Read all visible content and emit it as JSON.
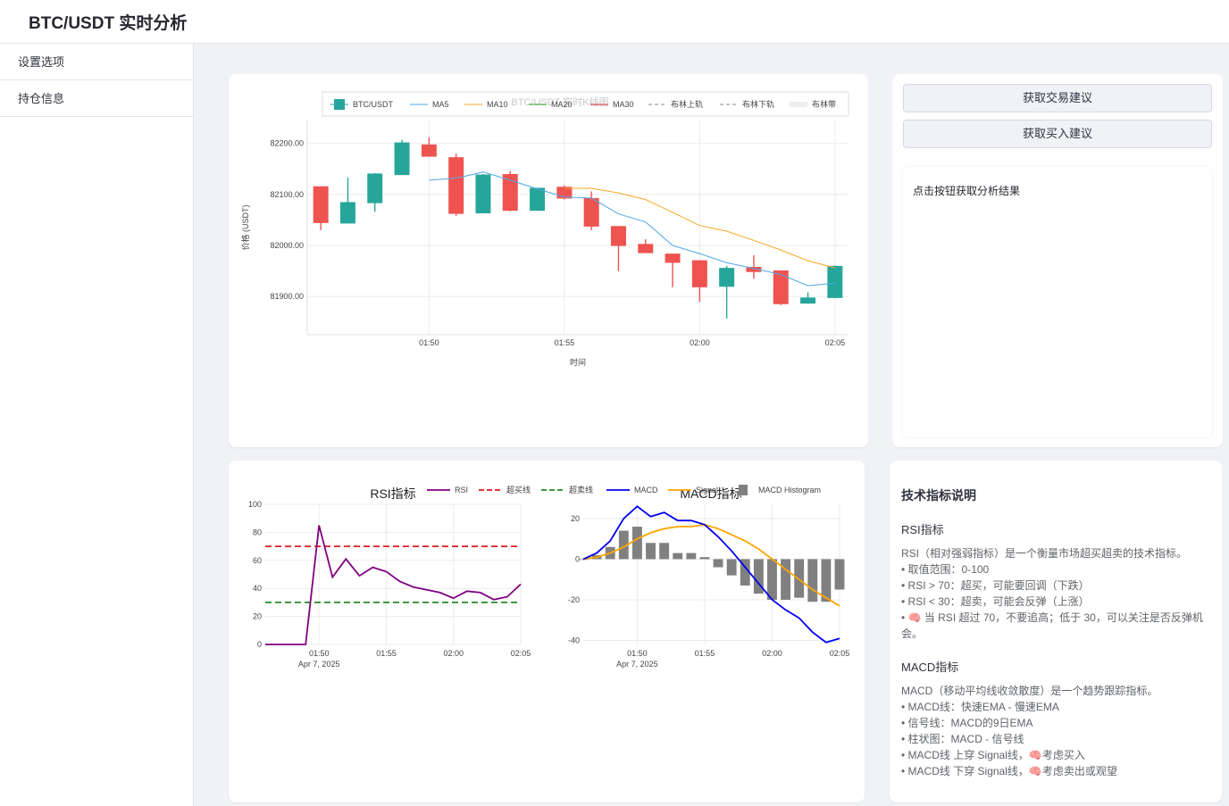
{
  "app": {
    "title": "BTC/USDT 实时分析"
  },
  "sidebar": {
    "items": [
      {
        "label": "设置选项"
      },
      {
        "label": "持仓信息"
      }
    ]
  },
  "actions": {
    "trade_advice_label": "获取交易建议",
    "buy_advice_label": "获取买入建议",
    "result_placeholder": "点击按钮获取分析结果"
  },
  "docs": {
    "title": "技术指标说明",
    "rsi": {
      "heading": "RSI指标",
      "lines": [
        "RSI（相对强弱指标）是一个衡量市场超买超卖的技术指标。",
        "• 取值范围：0-100",
        "• RSI > 70：超买，可能要回调（下跌）",
        "• RSI < 30：超卖，可能会反弹（上涨）",
        "• 🧠 当 RSI 超过 70，不要追高；低于 30，可以关注是否反弹机会。"
      ]
    },
    "macd": {
      "heading": "MACD指标",
      "lines": [
        "MACD（移动平均线收敛散度）是一个趋势跟踪指标。",
        "• MACD线：快速EMA - 慢速EMA",
        "• 信号线：MACD的9日EMA",
        "• 柱状图：MACD - 信号线",
        "• MACD线 上穿 Signal线，🧠考虑买入",
        "• MACD线 下穿 Signal线，🧠考虑卖出或观望"
      ]
    }
  },
  "chart_data": [
    {
      "type": "candlestick",
      "title": "BTC/USDT 实时K线图",
      "xlabel": "时间",
      "ylabel": "价格 (USDT)",
      "x_ticks": [
        "01:50",
        "01:55",
        "02:00",
        "02:05"
      ],
      "y_ticks": [
        "81900.00",
        "82000.00",
        "82100.00",
        "82200.00"
      ],
      "ylim": [
        81825,
        82245
      ],
      "legend": [
        "BTC/USDT",
        "MA5",
        "MA10",
        "MA20",
        "MA30",
        "布林上轨",
        "布林下轨",
        "布林带"
      ],
      "legend_placement": "top",
      "colors": {
        "up": "#26a69a",
        "down": "#ef5350",
        "ma5": "#4fa8e8",
        "ma10": "#f5a623",
        "ma20": "#2ca02c",
        "ma30": "#d62728",
        "boll": "#888888"
      },
      "candles": [
        {
          "t": "01:46",
          "o": 82116,
          "h": 82116,
          "l": 82030,
          "c": 82044
        },
        {
          "t": "01:47",
          "o": 82043,
          "h": 82133,
          "l": 82043,
          "c": 82085
        },
        {
          "t": "01:48",
          "o": 82083,
          "h": 82142,
          "l": 82066,
          "c": 82141
        },
        {
          "t": "01:49",
          "o": 82138,
          "h": 82207,
          "l": 82138,
          "c": 82202
        },
        {
          "t": "01:50",
          "o": 82198,
          "h": 82212,
          "l": 82174,
          "c": 82174
        },
        {
          "t": "01:51",
          "o": 82173,
          "h": 82180,
          "l": 82058,
          "c": 82062
        },
        {
          "t": "01:52",
          "o": 82063,
          "h": 82140,
          "l": 82063,
          "c": 82139
        },
        {
          "t": "01:53",
          "o": 82140,
          "h": 82146,
          "l": 82067,
          "c": 82068
        },
        {
          "t": "01:54",
          "o": 82068,
          "h": 82113,
          "l": 82068,
          "c": 82113
        },
        {
          "t": "01:55",
          "o": 82115,
          "h": 82118,
          "l": 82090,
          "c": 82092
        },
        {
          "t": "01:56",
          "o": 82093,
          "h": 82106,
          "l": 82030,
          "c": 82037
        },
        {
          "t": "01:57",
          "o": 82038,
          "h": 82038,
          "l": 81950,
          "c": 81999
        },
        {
          "t": "01:58",
          "o": 82003,
          "h": 82012,
          "l": 81985,
          "c": 81985
        },
        {
          "t": "01:59",
          "o": 81984,
          "h": 81984,
          "l": 81918,
          "c": 81966
        },
        {
          "t": "02:00",
          "o": 81971,
          "h": 81971,
          "l": 81889,
          "c": 81918
        },
        {
          "t": "02:01",
          "o": 81919,
          "h": 81960,
          "l": 81857,
          "c": 81956
        },
        {
          "t": "02:02",
          "o": 81958,
          "h": 81981,
          "l": 81935,
          "c": 81948
        },
        {
          "t": "02:03",
          "o": 81951,
          "h": 81951,
          "l": 81883,
          "c": 81885
        },
        {
          "t": "02:04",
          "o": 81886,
          "h": 81908,
          "l": 81886,
          "c": 81898
        },
        {
          "t": "02:05",
          "o": 81897,
          "h": 81961,
          "l": 81897,
          "c": 81960
        }
      ],
      "ma5": [
        null,
        null,
        null,
        null,
        82128,
        82132,
        82144,
        82128,
        82111,
        82095,
        82093,
        82062,
        82046,
        82000,
        81984,
        81966,
        81955,
        81943,
        81921,
        81926
      ],
      "ma10": [
        null,
        null,
        null,
        null,
        null,
        null,
        null,
        null,
        null,
        82112,
        82112,
        82103,
        82090,
        82065,
        82039,
        82028,
        82010,
        81991,
        81970,
        81956
      ]
    },
    {
      "type": "line",
      "title": "RSI指标",
      "x_ticks": [
        "01:50",
        "01:55",
        "02:00",
        "02:05"
      ],
      "x_subtitle": "Apr 7, 2025",
      "y_ticks": [
        "0",
        "20",
        "40",
        "60",
        "80",
        "100"
      ],
      "ylim": [
        0,
        100
      ],
      "legend": [
        "RSI",
        "超买线",
        "超卖线"
      ],
      "colors": {
        "rsi": "#800080",
        "overbought": "#e31a1c",
        "oversold": "#228b22"
      },
      "rsi": [
        0,
        0,
        0,
        0,
        85,
        48,
        61,
        49,
        55,
        52,
        45,
        41,
        39,
        37,
        33,
        38,
        37,
        32,
        34,
        43
      ],
      "overbought": 70,
      "oversold": 30
    },
    {
      "type": "line",
      "title": "MACD指标",
      "x_ticks": [
        "01:50",
        "01:55",
        "02:00",
        "02:05"
      ],
      "x_subtitle": "Apr 7, 2025",
      "y_ticks": [
        "-40",
        "-20",
        "0",
        "20"
      ],
      "ylim": [
        -42,
        27
      ],
      "legend": [
        "MACD",
        "Signal",
        "MACD Histogram"
      ],
      "colors": {
        "macd": "#0000ee",
        "signal": "#ffa500",
        "hist": "#808080"
      },
      "macd": [
        0,
        3,
        9,
        20,
        26,
        21,
        23,
        19,
        19,
        17,
        11,
        4,
        -4,
        -12,
        -20,
        -25,
        -29,
        -36,
        -41,
        -39
      ],
      "signal": [
        0,
        1,
        3,
        6,
        10,
        13,
        15,
        16,
        16,
        17,
        15,
        12,
        9,
        5,
        0,
        -5,
        -10,
        -15,
        -19,
        -23
      ],
      "hist": [
        0,
        2,
        6,
        14,
        16,
        8,
        8,
        3,
        3,
        1,
        -4,
        -8,
        -13,
        -17,
        -20,
        -20,
        -19,
        -21,
        -21,
        -15
      ]
    }
  ]
}
